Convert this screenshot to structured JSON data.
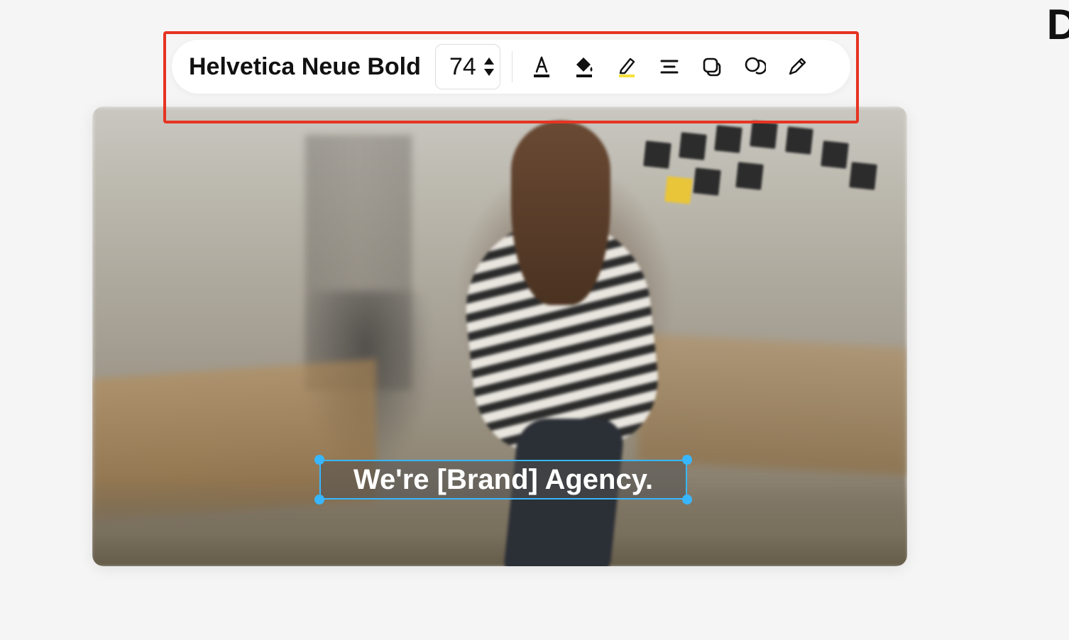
{
  "toolbar": {
    "font_name": "Helvetica Neue Bold",
    "font_size": "74",
    "icons": {
      "text_color": "text-color-icon",
      "fill_color": "fill-color-icon",
      "highlight_color": "highlight-color-icon",
      "align": "align-icon",
      "layer": "layer-icon",
      "effects": "effects-icon",
      "edit": "edit-pencil-icon"
    },
    "colors": {
      "text_underline": "#111111",
      "fill_underline": "#111111",
      "highlight_underline": "#f7e23a"
    }
  },
  "canvas": {
    "selected_text": "We're [Brand] Agency."
  },
  "annotation": {
    "highlight_box_color": "#e63322"
  }
}
